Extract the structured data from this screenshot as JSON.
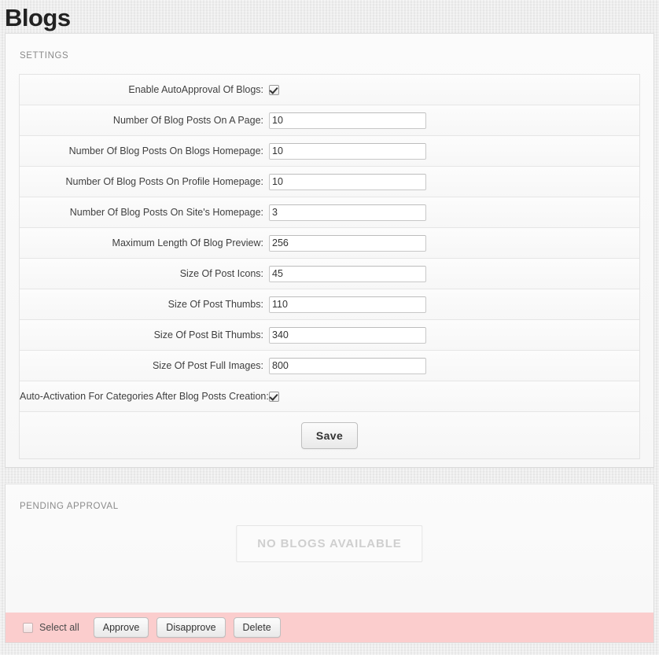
{
  "page": {
    "title": "Blogs"
  },
  "settings": {
    "heading": "SETTINGS",
    "rows": [
      {
        "label": "Enable AutoApproval Of Blogs:",
        "type": "checkbox",
        "checked": true
      },
      {
        "label": "Number Of Blog Posts On A Page:",
        "type": "text",
        "value": "10"
      },
      {
        "label": "Number Of Blog Posts On Blogs Homepage:",
        "type": "text",
        "value": "10"
      },
      {
        "label": "Number Of Blog Posts On Profile Homepage:",
        "type": "text",
        "value": "10"
      },
      {
        "label": "Number Of Blog Posts On Site's Homepage:",
        "type": "text",
        "value": "3"
      },
      {
        "label": "Maximum Length Of Blog Preview:",
        "type": "text",
        "value": "256"
      },
      {
        "label": "Size Of Post Icons:",
        "type": "text",
        "value": "45"
      },
      {
        "label": "Size Of Post Thumbs:",
        "type": "text",
        "value": "110"
      },
      {
        "label": "Size Of Post Bit Thumbs:",
        "type": "text",
        "value": "340"
      },
      {
        "label": "Size Of Post Full Images:",
        "type": "text",
        "value": "800"
      },
      {
        "label": "Auto-Activation For Categories After Blog Posts Creation:",
        "type": "checkbox",
        "checked": true
      }
    ],
    "save_label": "Save"
  },
  "pending": {
    "heading": "PENDING APPROVAL",
    "empty_message": "NO BLOGS AVAILABLE",
    "select_all_label": "Select all",
    "select_all_checked": false,
    "approve_label": "Approve",
    "disapprove_label": "Disapprove",
    "delete_label": "Delete"
  },
  "colors": {
    "page_background": "#e6e6e6",
    "panel_background": "#f9f9f9",
    "footer_background": "#fbcdcd",
    "heading_text": "#8a8a8a",
    "empty_text": "#cfcfcf"
  }
}
